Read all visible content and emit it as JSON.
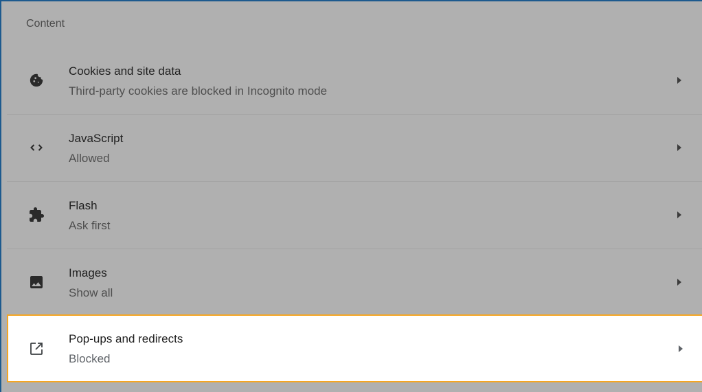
{
  "section": {
    "title": "Content"
  },
  "rows": [
    {
      "title": "Cookies and site data",
      "subtitle": "Third-party cookies are blocked in Incognito mode",
      "icon": "cookie-icon"
    },
    {
      "title": "JavaScript",
      "subtitle": "Allowed",
      "icon": "code-icon"
    },
    {
      "title": "Flash",
      "subtitle": "Ask first",
      "icon": "puzzle-icon"
    },
    {
      "title": "Images",
      "subtitle": "Show all",
      "icon": "image-icon"
    },
    {
      "title": "Pop-ups and redirects",
      "subtitle": "Blocked",
      "icon": "open-in-new-icon",
      "highlighted": true
    }
  ],
  "colors": {
    "overlay": "#b0b0b0",
    "highlight_border": "#f5a623",
    "window_border": "#1d5a8e"
  }
}
